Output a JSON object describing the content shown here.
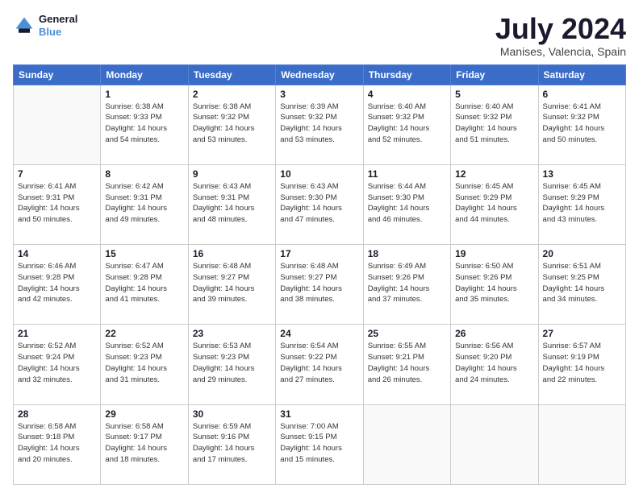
{
  "logo": {
    "line1": "General",
    "line2": "Blue",
    "icon_color": "#4a90d9"
  },
  "header": {
    "title": "July 2024",
    "subtitle": "Manises, Valencia, Spain"
  },
  "days_of_week": [
    "Sunday",
    "Monday",
    "Tuesday",
    "Wednesday",
    "Thursday",
    "Friday",
    "Saturday"
  ],
  "weeks": [
    [
      {
        "day": "",
        "info": ""
      },
      {
        "day": "1",
        "info": "Sunrise: 6:38 AM\nSunset: 9:33 PM\nDaylight: 14 hours\nand 54 minutes."
      },
      {
        "day": "2",
        "info": "Sunrise: 6:38 AM\nSunset: 9:32 PM\nDaylight: 14 hours\nand 53 minutes."
      },
      {
        "day": "3",
        "info": "Sunrise: 6:39 AM\nSunset: 9:32 PM\nDaylight: 14 hours\nand 53 minutes."
      },
      {
        "day": "4",
        "info": "Sunrise: 6:40 AM\nSunset: 9:32 PM\nDaylight: 14 hours\nand 52 minutes."
      },
      {
        "day": "5",
        "info": "Sunrise: 6:40 AM\nSunset: 9:32 PM\nDaylight: 14 hours\nand 51 minutes."
      },
      {
        "day": "6",
        "info": "Sunrise: 6:41 AM\nSunset: 9:32 PM\nDaylight: 14 hours\nand 50 minutes."
      }
    ],
    [
      {
        "day": "7",
        "info": "Sunrise: 6:41 AM\nSunset: 9:31 PM\nDaylight: 14 hours\nand 50 minutes."
      },
      {
        "day": "8",
        "info": "Sunrise: 6:42 AM\nSunset: 9:31 PM\nDaylight: 14 hours\nand 49 minutes."
      },
      {
        "day": "9",
        "info": "Sunrise: 6:43 AM\nSunset: 9:31 PM\nDaylight: 14 hours\nand 48 minutes."
      },
      {
        "day": "10",
        "info": "Sunrise: 6:43 AM\nSunset: 9:30 PM\nDaylight: 14 hours\nand 47 minutes."
      },
      {
        "day": "11",
        "info": "Sunrise: 6:44 AM\nSunset: 9:30 PM\nDaylight: 14 hours\nand 46 minutes."
      },
      {
        "day": "12",
        "info": "Sunrise: 6:45 AM\nSunset: 9:29 PM\nDaylight: 14 hours\nand 44 minutes."
      },
      {
        "day": "13",
        "info": "Sunrise: 6:45 AM\nSunset: 9:29 PM\nDaylight: 14 hours\nand 43 minutes."
      }
    ],
    [
      {
        "day": "14",
        "info": "Sunrise: 6:46 AM\nSunset: 9:28 PM\nDaylight: 14 hours\nand 42 minutes."
      },
      {
        "day": "15",
        "info": "Sunrise: 6:47 AM\nSunset: 9:28 PM\nDaylight: 14 hours\nand 41 minutes."
      },
      {
        "day": "16",
        "info": "Sunrise: 6:48 AM\nSunset: 9:27 PM\nDaylight: 14 hours\nand 39 minutes."
      },
      {
        "day": "17",
        "info": "Sunrise: 6:48 AM\nSunset: 9:27 PM\nDaylight: 14 hours\nand 38 minutes."
      },
      {
        "day": "18",
        "info": "Sunrise: 6:49 AM\nSunset: 9:26 PM\nDaylight: 14 hours\nand 37 minutes."
      },
      {
        "day": "19",
        "info": "Sunrise: 6:50 AM\nSunset: 9:26 PM\nDaylight: 14 hours\nand 35 minutes."
      },
      {
        "day": "20",
        "info": "Sunrise: 6:51 AM\nSunset: 9:25 PM\nDaylight: 14 hours\nand 34 minutes."
      }
    ],
    [
      {
        "day": "21",
        "info": "Sunrise: 6:52 AM\nSunset: 9:24 PM\nDaylight: 14 hours\nand 32 minutes."
      },
      {
        "day": "22",
        "info": "Sunrise: 6:52 AM\nSunset: 9:23 PM\nDaylight: 14 hours\nand 31 minutes."
      },
      {
        "day": "23",
        "info": "Sunrise: 6:53 AM\nSunset: 9:23 PM\nDaylight: 14 hours\nand 29 minutes."
      },
      {
        "day": "24",
        "info": "Sunrise: 6:54 AM\nSunset: 9:22 PM\nDaylight: 14 hours\nand 27 minutes."
      },
      {
        "day": "25",
        "info": "Sunrise: 6:55 AM\nSunset: 9:21 PM\nDaylight: 14 hours\nand 26 minutes."
      },
      {
        "day": "26",
        "info": "Sunrise: 6:56 AM\nSunset: 9:20 PM\nDaylight: 14 hours\nand 24 minutes."
      },
      {
        "day": "27",
        "info": "Sunrise: 6:57 AM\nSunset: 9:19 PM\nDaylight: 14 hours\nand 22 minutes."
      }
    ],
    [
      {
        "day": "28",
        "info": "Sunrise: 6:58 AM\nSunset: 9:18 PM\nDaylight: 14 hours\nand 20 minutes."
      },
      {
        "day": "29",
        "info": "Sunrise: 6:58 AM\nSunset: 9:17 PM\nDaylight: 14 hours\nand 18 minutes."
      },
      {
        "day": "30",
        "info": "Sunrise: 6:59 AM\nSunset: 9:16 PM\nDaylight: 14 hours\nand 17 minutes."
      },
      {
        "day": "31",
        "info": "Sunrise: 7:00 AM\nSunset: 9:15 PM\nDaylight: 14 hours\nand 15 minutes."
      },
      {
        "day": "",
        "info": ""
      },
      {
        "day": "",
        "info": ""
      },
      {
        "day": "",
        "info": ""
      }
    ]
  ]
}
